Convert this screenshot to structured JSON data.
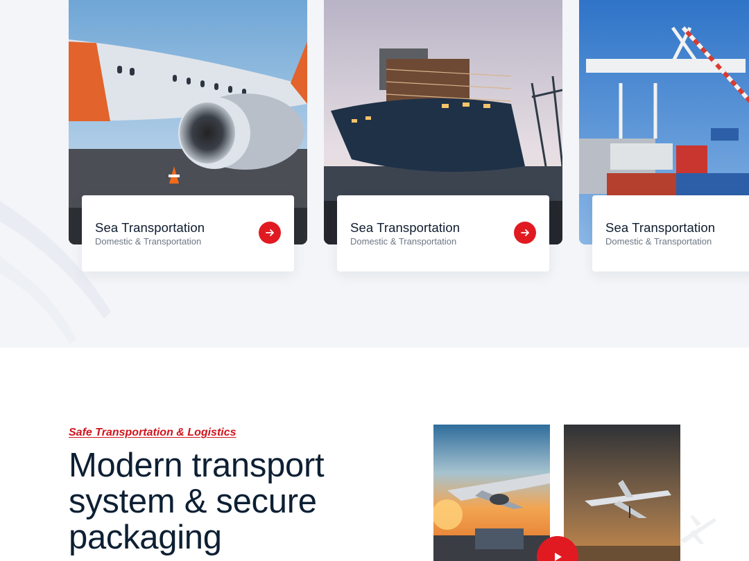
{
  "service_cards": [
    {
      "title": "Sea Transportation",
      "subtitle": "Domestic & Transportation",
      "image": "airplane-engine-photo",
      "action_icon": "arrow-right-icon"
    },
    {
      "title": "Sea Transportation",
      "subtitle": "Domestic & Transportation",
      "image": "container-ship-photo",
      "action_icon": "arrow-right-icon"
    },
    {
      "title": "Sea Transportation",
      "subtitle": "Domestic & Transportation",
      "image": "port-crane-photo",
      "action_icon": "arrow-right-icon"
    }
  ],
  "about": {
    "kicker": "Safe Transportation & Logistics",
    "headline": "Modern transport system & secure packaging",
    "photos": [
      "sunset-plane-truck-photo",
      "plane-takeoff-photo"
    ],
    "play_icon": "play-icon"
  },
  "colors": {
    "accent": "#e11a22",
    "heading": "#0d1f33",
    "band_background": "#f3f5f8"
  }
}
